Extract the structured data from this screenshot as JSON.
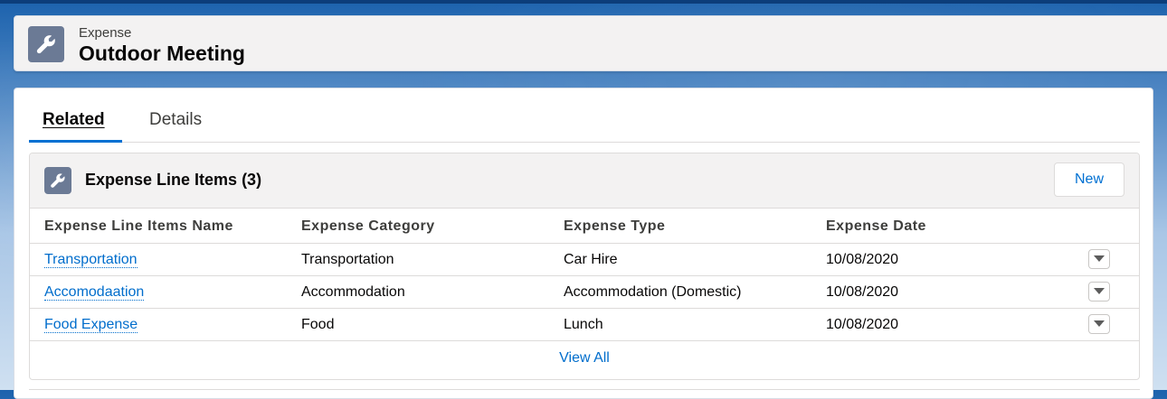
{
  "colors": {
    "brand_blue": "#0070d2",
    "link_blue": "#006dcc",
    "object_icon_bg": "#6b7a95"
  },
  "header": {
    "object_type": "Expense",
    "record_name": "Outdoor Meeting",
    "icon": "wrench-icon"
  },
  "tabs": [
    {
      "label": "Related",
      "active": true
    },
    {
      "label": "Details",
      "active": false
    }
  ],
  "related_list": {
    "icon": "wrench-icon",
    "title": "Expense Line Items (3)",
    "new_button_label": "New",
    "columns": [
      "Expense Line Items Name",
      "Expense Category",
      "Expense Type",
      "Expense Date"
    ],
    "rows": [
      {
        "name": "Transportation",
        "category": "Transportation",
        "type": "Car Hire",
        "date": "10/08/2020"
      },
      {
        "name": "Accomodaation",
        "category": "Accommodation",
        "type": "Accommodation (Domestic)",
        "date": "10/08/2020"
      },
      {
        "name": "Food Expense",
        "category": "Food",
        "type": "Lunch",
        "date": "10/08/2020"
      }
    ],
    "row_action_icon": "chevron-down-icon",
    "view_all_label": "View All"
  }
}
